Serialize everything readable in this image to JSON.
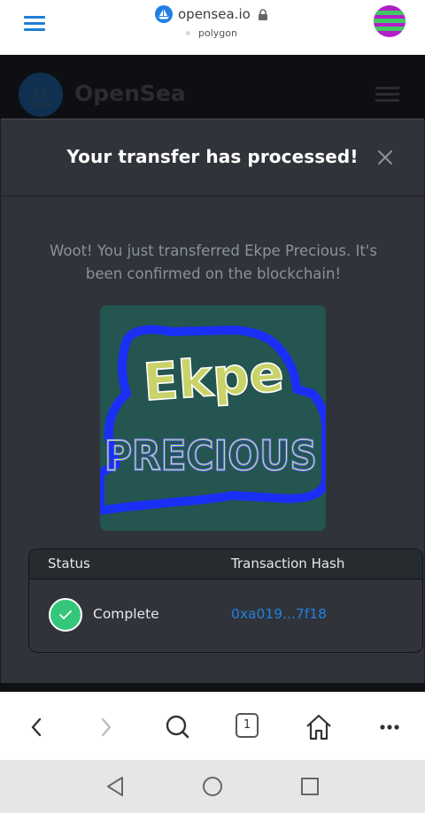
{
  "browser": {
    "url": "opensea.io",
    "network": "polygon",
    "tab_count": "1"
  },
  "site": {
    "brand": "OpenSea"
  },
  "modal": {
    "title": "Your transfer has processed!",
    "message": "Woot! You just transferred Ekpe Precious. It's been confirmed on the blockchain!",
    "table": {
      "headers": [
        "Status",
        "Transaction Hash"
      ],
      "row": {
        "status": "Complete",
        "hash": "0xa019...7f18"
      }
    }
  },
  "nft_art": {
    "word1": "Ekpe",
    "word2": "PRECIOUS"
  },
  "icons": [
    "hamburger-icon",
    "opensea-icon",
    "lock-icon",
    "avatar",
    "close-icon",
    "check-icon",
    "back-icon",
    "forward-icon",
    "search-icon",
    "tabs-icon",
    "home-icon",
    "more-icon",
    "nav-back-icon",
    "nav-home-icon",
    "nav-recents-icon"
  ],
  "colors": {
    "accent": "#2081e2",
    "success": "#34c77b",
    "modal_bg": "#303339"
  }
}
